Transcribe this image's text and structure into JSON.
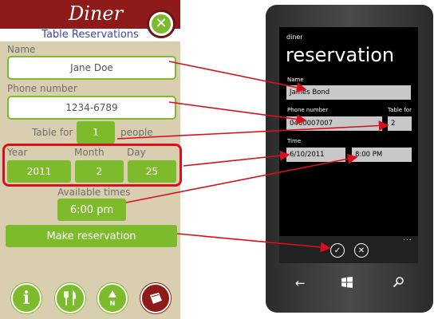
{
  "android": {
    "logo": "Diner",
    "title": "Table Reservations",
    "name_label": "Name",
    "name_value": "Jane Doe",
    "phone_label": "Phone number",
    "phone_value": "1234-6789",
    "table_prefix": "Table for",
    "table_value": "1",
    "table_suffix": "people",
    "year_label": "Year",
    "month_label": "Month",
    "day_label": "Day",
    "year_value": "2011",
    "month_value": "2",
    "day_value": "25",
    "times_label": "Available times",
    "time_value": "6:00 pm",
    "submit_label": "Make reservation",
    "nav_icons": [
      "info-icon",
      "fork-knife-icon",
      "compass-icon",
      "menu-book-icon"
    ]
  },
  "wp": {
    "app_name": "diner",
    "page_title": "reservation",
    "name_label": "Name",
    "name_value": "James Bond",
    "phone_label": "Phone number",
    "phone_value": "0400007007",
    "table_label": "Table for",
    "table_value": "2",
    "time_label": "Time",
    "date_value": "6/10/2011",
    "time_value": "8:00 PM",
    "more": "...",
    "appbar_icons": [
      "check-icon",
      "cancel-icon"
    ],
    "hardware_icons": [
      "back-icon",
      "windows-icon",
      "search-icon"
    ]
  },
  "colors": {
    "android_header": "#8e1a19",
    "android_green": "#7dba2c",
    "android_background": "#d9cfb0",
    "title_blue": "#3b47a0",
    "arrow_red": "#d8101c"
  }
}
